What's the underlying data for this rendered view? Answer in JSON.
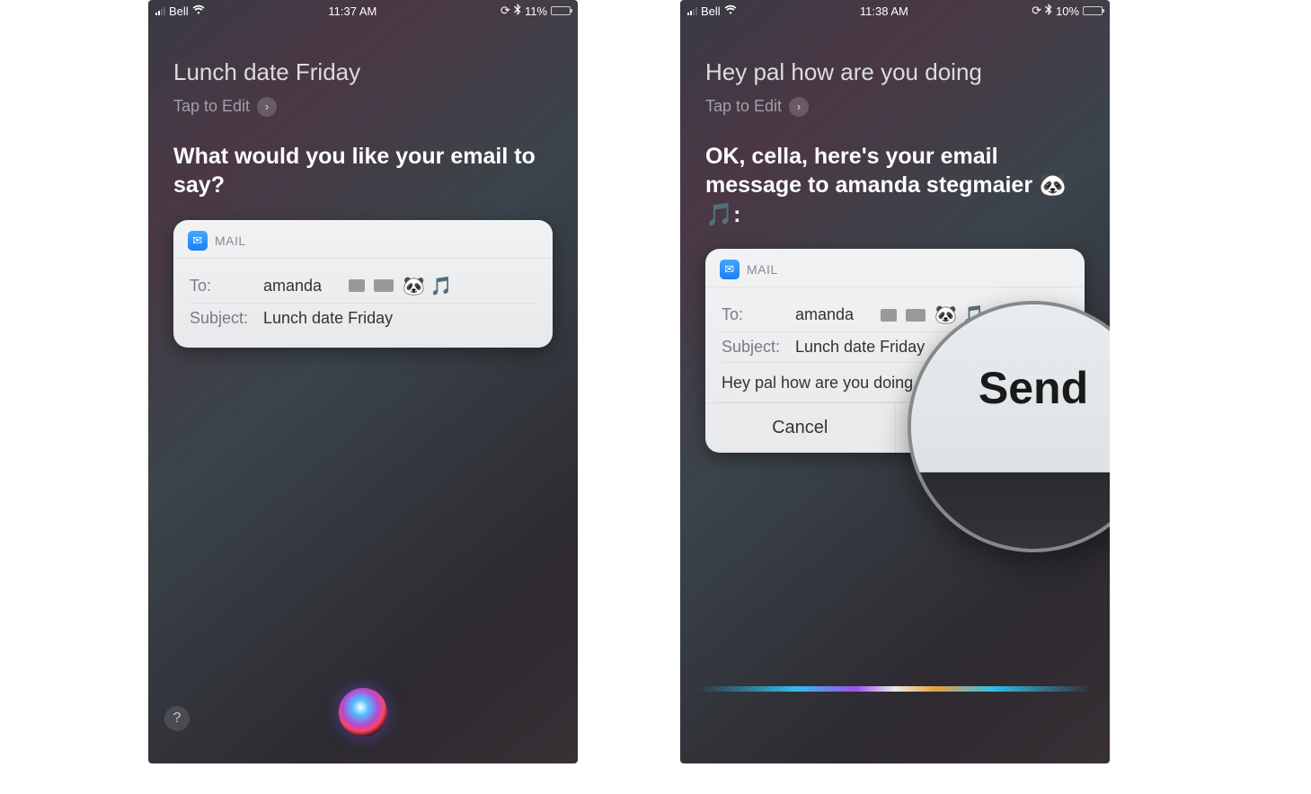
{
  "left": {
    "status": {
      "carrier": "Bell",
      "time": "11:37 AM",
      "battery": "11%"
    },
    "userPhrase": "Lunch date Friday",
    "tapEdit": "Tap to Edit",
    "siri": "What would you like your email to say?",
    "mail": {
      "app": "MAIL",
      "toLabel": "To:",
      "toValue": "amanda",
      "toEmoji": "🐼 🎵",
      "subjectLabel": "Subject:",
      "subjectValue": "Lunch date Friday"
    }
  },
  "right": {
    "status": {
      "carrier": "Bell",
      "time": "11:38 AM",
      "battery": "10%"
    },
    "userPhrase": "Hey pal how are you doing",
    "tapEdit": "Tap to Edit",
    "siri": "OK, cella, here's your email message to amanda stegmaier 🐼🎵:",
    "mail": {
      "app": "MAIL",
      "toLabel": "To:",
      "toValue": "amanda",
      "toEmoji": "🐼 🎵",
      "subjectLabel": "Subject:",
      "subjectValue": "Lunch date Friday",
      "body": "Hey pal how are you doing",
      "cancel": "Cancel",
      "send": "Send"
    },
    "zoomLabel": "Send"
  },
  "help": "?"
}
